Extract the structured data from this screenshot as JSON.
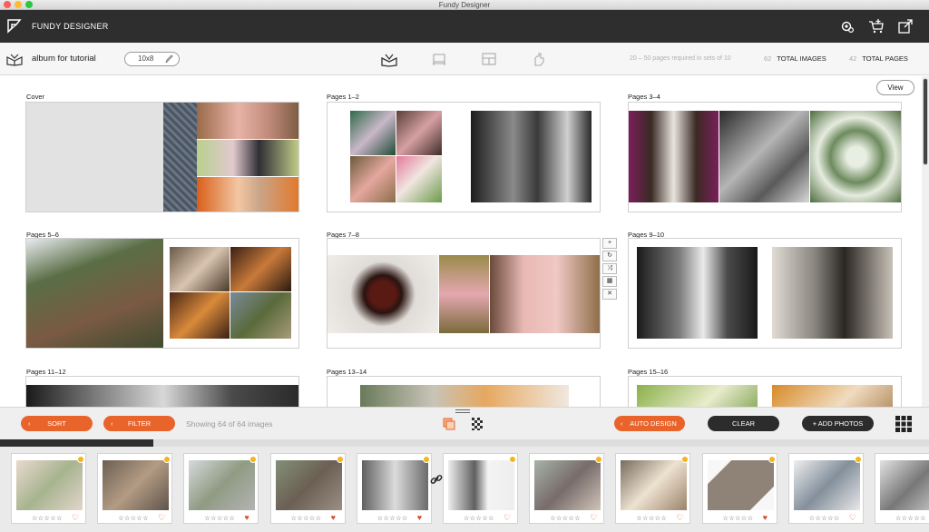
{
  "window": {
    "title": "Fundy Designer"
  },
  "appbar": {
    "brand": "FUNDY DESIGNER",
    "icons": [
      "settings-icon",
      "cart-add-icon",
      "export-icon"
    ]
  },
  "toolbar": {
    "album_name": "album for tutorial",
    "size": "10x8",
    "view_icons": [
      "album-view-icon",
      "bed-icon",
      "layout-icon",
      "hand-icon"
    ],
    "requirement": "20 – 50 pages required in sets of 10",
    "total_images_count": "62",
    "total_images_label": "TOTAL IMAGES",
    "total_pages_count": "42",
    "total_pages_label": "TOTAL PAGES"
  },
  "workspace": {
    "view_button": "View",
    "spreads": [
      {
        "label": "Cover"
      },
      {
        "label": "Pages 1–2"
      },
      {
        "label": "Pages 3–4"
      },
      {
        "label": "Pages 5–6"
      },
      {
        "label": "Pages 7–8"
      },
      {
        "label": "Pages 9–10"
      },
      {
        "label": "Pages 11–12"
      },
      {
        "label": "Pages 13–14"
      },
      {
        "label": "Pages 15–16"
      }
    ],
    "spread_tools": [
      "+",
      "↻",
      "⤨",
      "▦",
      "✕"
    ]
  },
  "controls": {
    "sort": "SORT",
    "filter": "FILTER",
    "showing": "Showing 64 of 64 images",
    "auto_design": "AUTO DESIGN",
    "clear": "CLEAR",
    "add_photos": "+ ADD PHOTOS"
  },
  "progress": {
    "fraction": 0.165
  },
  "filmstrip": {
    "items": [
      {
        "stars": "☆☆☆☆☆",
        "favorite": false
      },
      {
        "stars": "☆☆☆☆☆",
        "favorite": false
      },
      {
        "stars": "☆☆☆☆☆",
        "favorite": true
      },
      {
        "stars": "☆☆☆☆☆",
        "favorite": true
      },
      {
        "stars": "☆☆☆☆☆",
        "favorite": true
      },
      {
        "stars": "☆☆☆☆☆",
        "favorite": false
      },
      {
        "stars": "☆☆☆☆☆",
        "favorite": false
      },
      {
        "stars": "☆☆☆☆☆",
        "favorite": false
      },
      {
        "stars": "☆☆☆☆☆",
        "favorite": true
      },
      {
        "stars": "☆☆☆☆☆",
        "favorite": false
      },
      {
        "stars": "☆☆☆☆☆",
        "favorite": false
      }
    ]
  },
  "colors": {
    "accent": "#e8642a",
    "header": "#2e2e2e",
    "badge": "#f2b51c"
  }
}
